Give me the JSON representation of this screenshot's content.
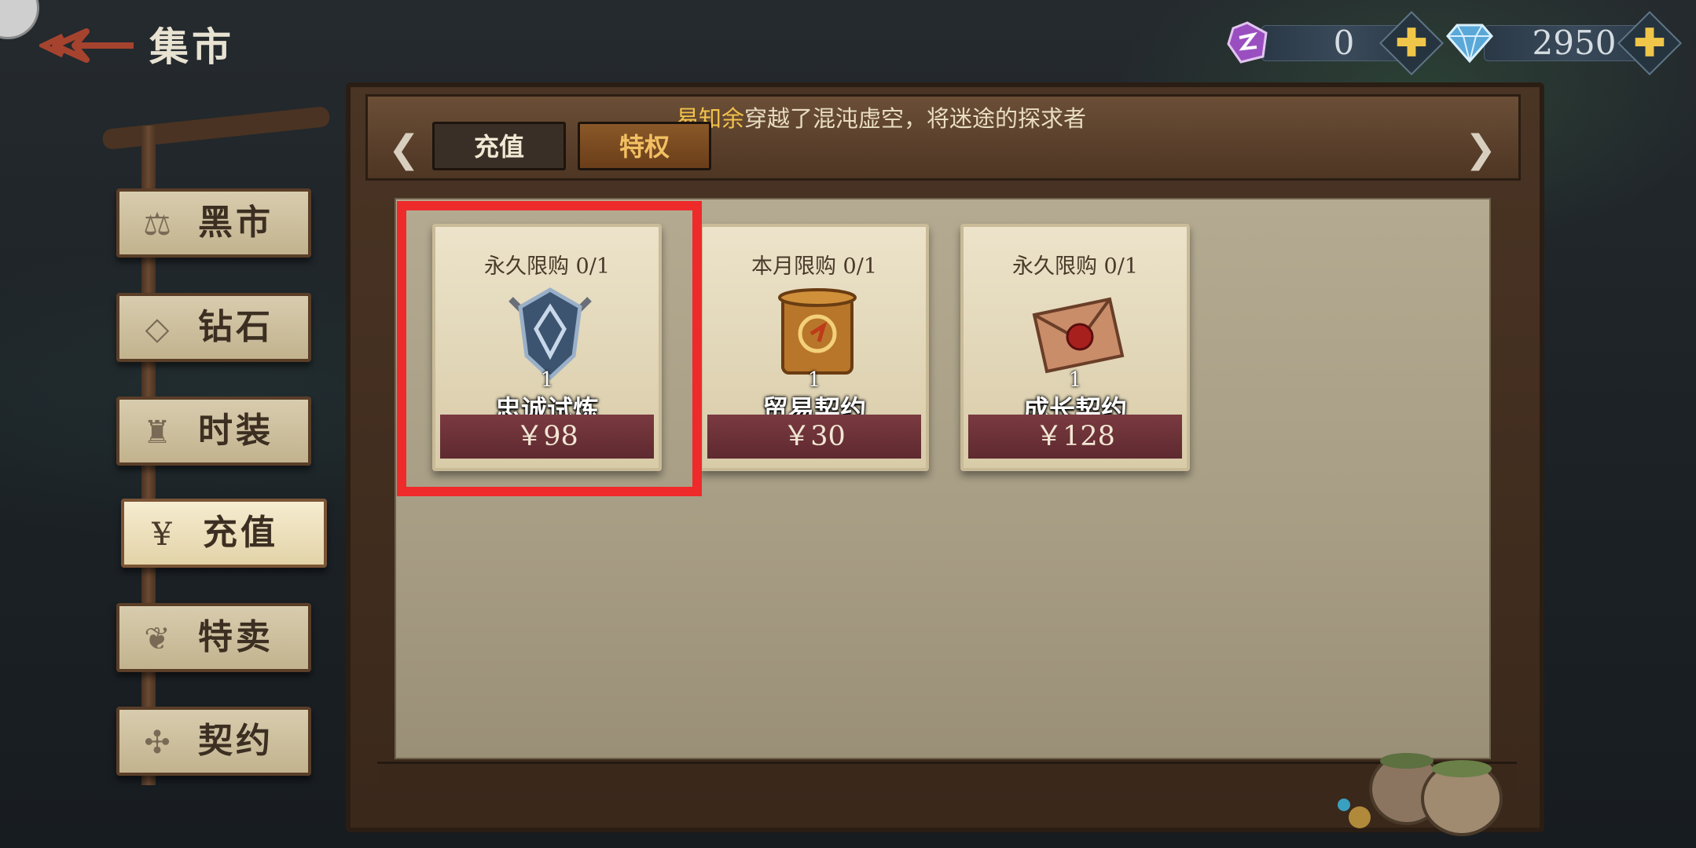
{
  "header": {
    "title": "集市",
    "currencies": [
      {
        "icon": "purple-token-icon",
        "value": "0"
      },
      {
        "icon": "diamond-icon",
        "value": "2950"
      }
    ],
    "plus_label": "✚"
  },
  "menu": {
    "items": [
      {
        "label": "黑市",
        "icon": "scales-icon",
        "active": false
      },
      {
        "label": "钻石",
        "icon": "diamond-icon",
        "active": false
      },
      {
        "label": "时装",
        "icon": "outfit-icon",
        "active": false
      },
      {
        "label": "充值",
        "icon": "money-bag-icon",
        "active": true
      },
      {
        "label": "特卖",
        "icon": "tag-icon",
        "active": false
      },
      {
        "label": "契约",
        "icon": "puzzle-icon",
        "active": false
      }
    ]
  },
  "marquee": {
    "name": "易知余",
    "text": "穿越了混沌虚空，将迷途的探求者"
  },
  "tabs": [
    {
      "label": "充值",
      "active": true
    },
    {
      "label": "特权",
      "active": false
    }
  ],
  "cards": [
    {
      "limit": "永久限购 0/1",
      "name": "忠诚试炼",
      "qty": "1",
      "price": "￥98",
      "icon": "shield-emblem-icon"
    },
    {
      "limit": "本月限购 0/1",
      "name": "贸易契约",
      "qty": "1",
      "price": "￥30",
      "icon": "scroll-icon"
    },
    {
      "limit": "永久限购 0/1",
      "name": "成长契约",
      "qty": "1",
      "price": "￥128",
      "icon": "sealed-letter-icon"
    }
  ],
  "colors": {
    "highlight": "#ee2a2a",
    "price_band": "#6e3238",
    "currency_plus": "#f0c64a",
    "marquee_name": "#f2c14a"
  }
}
